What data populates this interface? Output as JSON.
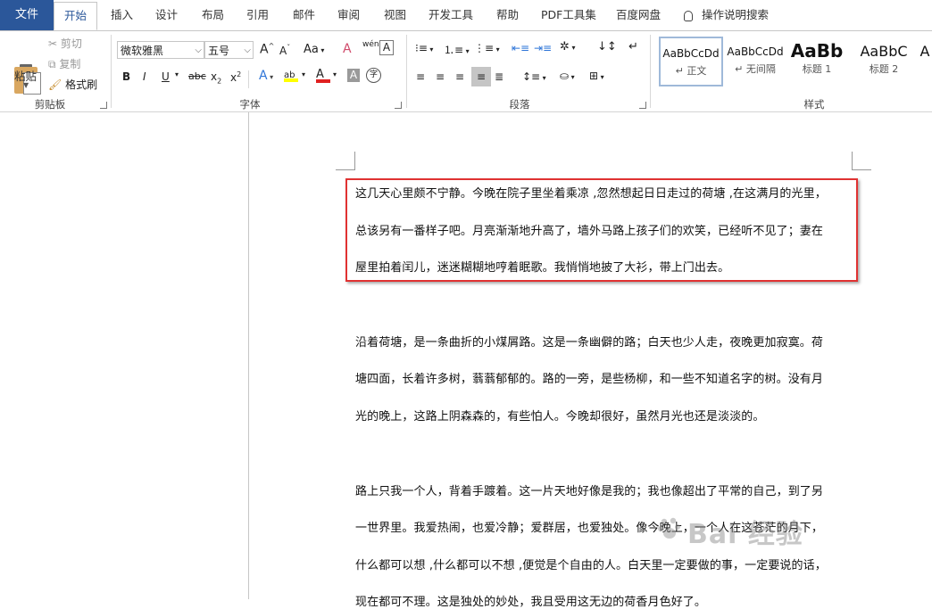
{
  "menubar": {
    "file_label": "文件",
    "tabs": [
      {
        "label": "开始"
      },
      {
        "label": "插入"
      },
      {
        "label": "设计"
      },
      {
        "label": "布局"
      },
      {
        "label": "引用"
      },
      {
        "label": "邮件"
      },
      {
        "label": "审阅"
      },
      {
        "label": "视图"
      },
      {
        "label": "开发工具"
      },
      {
        "label": "帮助"
      },
      {
        "label": "PDF工具集"
      },
      {
        "label": "百度网盘"
      }
    ],
    "tell_me": "操作说明搜索"
  },
  "ribbon": {
    "clipboard": {
      "paste": "粘贴",
      "cut": "剪切",
      "copy": "复制",
      "format_painter": "格式刷",
      "group_label": "剪贴板"
    },
    "font": {
      "font_name": "微软雅黑",
      "font_size": "五号",
      "grow": "A",
      "shrink": "A",
      "change_case": "Aa",
      "clear_format": "A",
      "phonetic": "wén",
      "bold": "B",
      "italic": "I",
      "underline": "U",
      "strike": "abc",
      "subscript": "x",
      "superscript": "x",
      "text_effects": "A",
      "highlight": "ab",
      "font_color": "A",
      "char_shading": "A",
      "enclose": "字",
      "group_label": "字体"
    },
    "paragraph": {
      "group_label": "段落"
    },
    "styles": {
      "items": [
        {
          "sample": "AaBbCcDd",
          "name": "正文"
        },
        {
          "sample": "AaBbCcDd",
          "name": "无间隔"
        },
        {
          "sample": "AaBb",
          "name": "标题 1"
        },
        {
          "sample": "AaBbC",
          "name": "标题 2"
        },
        {
          "sample": "A",
          "name": ""
        }
      ],
      "group_label": "样式"
    },
    "colors": {
      "highlight": "#ffff00",
      "font_color": "#e02020"
    }
  },
  "document": {
    "paragraph1": [
      "这几天心里颇不宁静。今晚在院子里坐着乘凉 ,忽然想起日日走过的荷塘 ,在这满月的光里，",
      "总该另有一番样子吧。月亮渐渐地升高了，墙外马路上孩子们的欢笑，已经听不见了；妻在",
      "屋里拍着闰儿，迷迷糊糊地哼着眠歌。我悄悄地披了大衫，带上门出去。"
    ],
    "paragraph2": [
      "沿着荷塘，是一条曲折的小煤屑路。这是一条幽僻的路；白天也少人走，夜晚更加寂寞。荷",
      "塘四面，长着许多树，蓊蓊郁郁的。路的一旁，是些杨柳，和一些不知道名字的树。没有月",
      "光的晚上，这路上阴森森的，有些怕人。今晚却很好，虽然月光也还是淡淡的。"
    ],
    "paragraph3": [
      "路上只我一个人，背着手踱着。这一片天地好像是我的；我也像超出了平常的自己，到了另",
      "一世界里。我爱热闹，也爱冷静；爱群居，也爱独处。像今晚上，一个人在这苍茫的月下，",
      "什么都可以想 ,什么都可以不想 ,便觉是个自由的人。白天里一定要做的事，一定要说的话，",
      "现在都可不理。这是独处的妙处，我且受用这无边的荷香月色好了。"
    ],
    "highlight_color": "#e03232"
  },
  "watermark": "Bai 经验"
}
